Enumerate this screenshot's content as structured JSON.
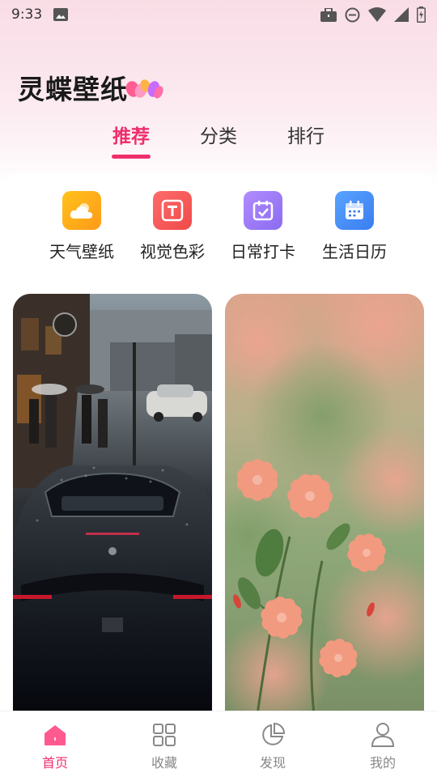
{
  "status_bar": {
    "time": "9:33",
    "left_icons": [
      "image-icon"
    ],
    "right_icons": [
      "briefcase-icon",
      "do-not-disturb-icon",
      "wifi-icon",
      "signal-icon",
      "battery-charging-icon"
    ]
  },
  "app": {
    "title": "灵蝶壁纸",
    "accent_color": "#ee2f6c"
  },
  "tabs": [
    {
      "label": "推荐",
      "active": true
    },
    {
      "label": "分类",
      "active": false
    },
    {
      "label": "排行",
      "active": false
    }
  ],
  "quick_entries": [
    {
      "label": "天气壁纸",
      "icon": "weather-cloud-icon",
      "color": "#ffa51a"
    },
    {
      "label": "视觉色彩",
      "icon": "text-t-icon",
      "color": "#f45a5a"
    },
    {
      "label": "日常打卡",
      "icon": "calendar-check-icon",
      "color": "#9b7cf2"
    },
    {
      "label": "生活日历",
      "icon": "calendar-icon",
      "color": "#3f8cf5"
    }
  ],
  "wallpapers": [
    {
      "subject": "sports-car-in-rain"
    },
    {
      "subject": "pink-azalea-flowers"
    }
  ],
  "bottom_nav": [
    {
      "label": "首页",
      "icon": "home-icon",
      "active": true
    },
    {
      "label": "收藏",
      "icon": "grid-icon",
      "active": false
    },
    {
      "label": "发现",
      "icon": "pie-chart-icon",
      "active": false
    },
    {
      "label": "我的",
      "icon": "user-icon",
      "active": false
    }
  ]
}
